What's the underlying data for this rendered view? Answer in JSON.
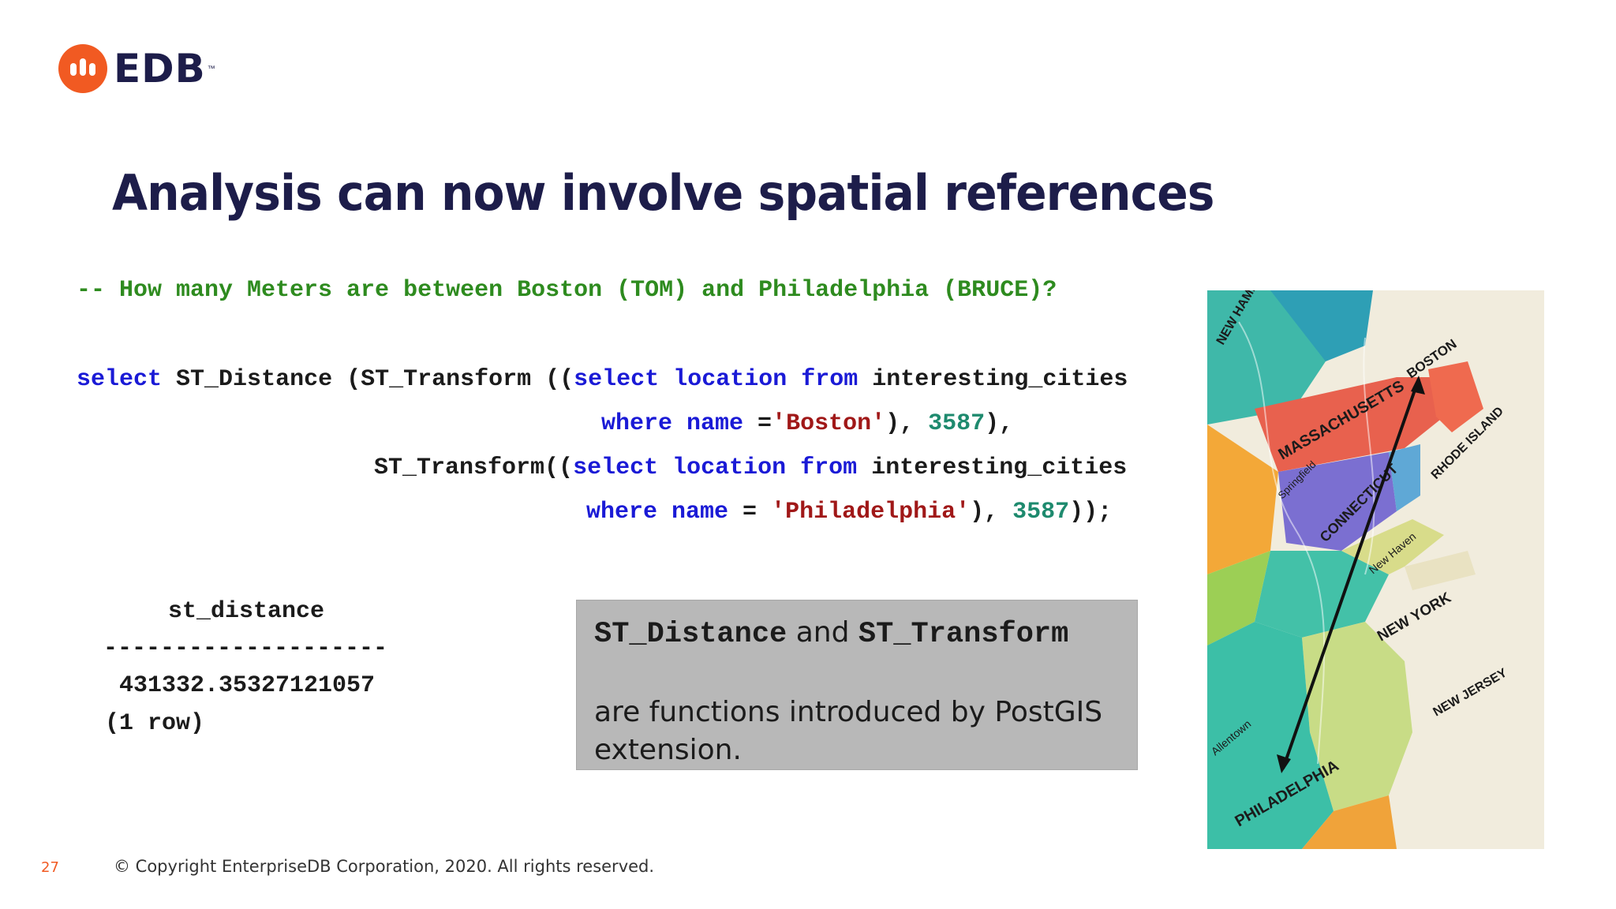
{
  "logo": {
    "text": "EDB",
    "tm": "™"
  },
  "title": "Analysis can now involve spatial references",
  "code": {
    "comment": "-- How many Meters are between Boston (TOM) and Philadelphia (BRUCE)?",
    "kw_select": "select",
    "kw_from": "from",
    "kw_where": "where",
    "kw_name": "name",
    "kw_location": "location",
    "fn_distance": "ST_Distance",
    "fn_transform": "ST_Transform",
    "table": "interesting_cities",
    "str_boston": "'Boston'",
    "str_philadelphia": "'Philadelphia'",
    "srid": "3587"
  },
  "result": {
    "header": "st_distance",
    "separator": "--------------------",
    "value": "431332.35327121057",
    "rowcount": "(1 row)"
  },
  "callout": {
    "fn1": "ST_Distance",
    "and": "and",
    "fn2": "ST_Transform",
    "body": "are functions introduced by PostGIS extension."
  },
  "map": {
    "labels": [
      "NEW HAMPSHIRE",
      "MASSACHUSETTS",
      "BOSTON",
      "CONNECTICUT",
      "RHODE ISLAND",
      "NEW YORK",
      "NEW JERSEY",
      "PHILADELPHIA",
      "New Haven",
      "Springfield",
      "Allentown"
    ]
  },
  "footer": {
    "page": "27",
    "copyright": "© Copyright EnterpriseDB Corporation, 2020. All rights reserved."
  }
}
